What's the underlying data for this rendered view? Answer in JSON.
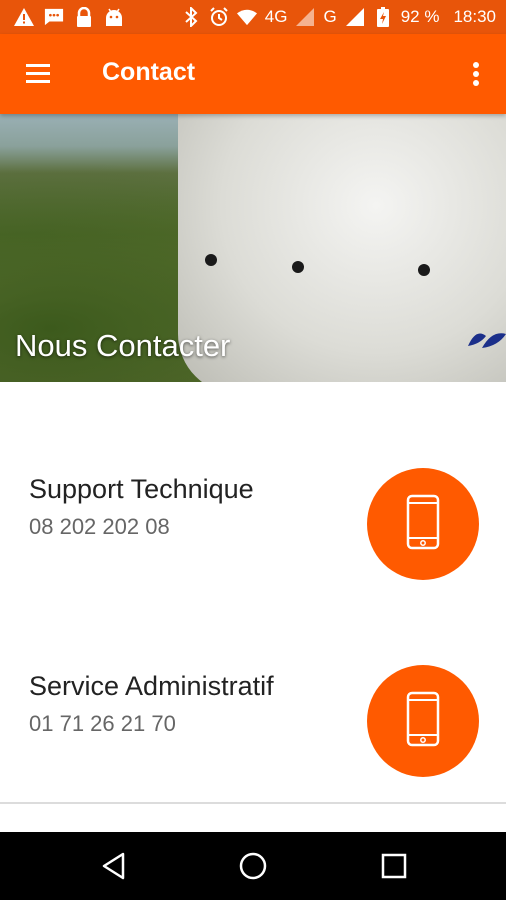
{
  "status_bar": {
    "battery": "92 %",
    "time": "18:30",
    "network_1": "4G",
    "network_2": "G",
    "icons": [
      "warning-icon",
      "message-icon",
      "lock-icon",
      "android-icon",
      "bluetooth-icon",
      "alarm-icon",
      "wifi-icon",
      "signal-icon",
      "battery-icon"
    ]
  },
  "app_bar": {
    "title": "Contact",
    "menu_icon": "hamburger-menu-icon",
    "more_icon": "more-vert-icon"
  },
  "hero": {
    "heading": "Nous Contacter"
  },
  "contacts": [
    {
      "name": "Support Technique",
      "phone": "08 202 202 08",
      "icon": "smartphone-icon"
    },
    {
      "name": "Service Administratif",
      "phone": "01 71 26 21 70",
      "icon": "smartphone-icon"
    }
  ],
  "colors": {
    "status_bar": "#e8550a",
    "app_bar": "#ff5a00",
    "accent": "#ff5a00",
    "nav_bar": "#000000"
  },
  "nav_bar": {
    "icons": [
      "back-icon",
      "home-icon",
      "recents-icon"
    ]
  }
}
